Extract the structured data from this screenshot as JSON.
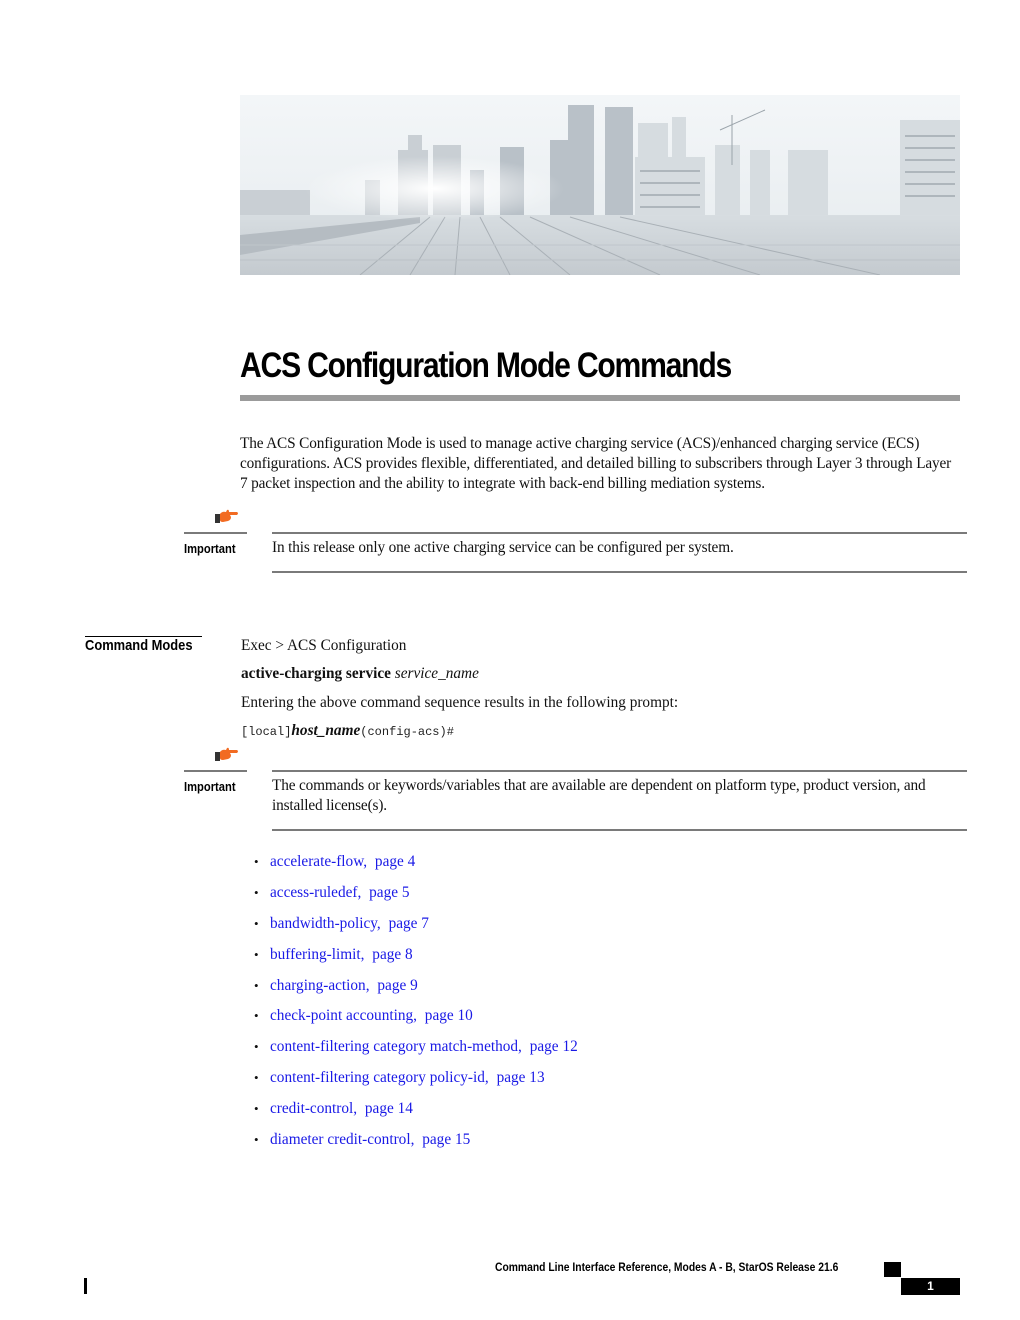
{
  "hero": {
    "image_alt": "City skyline viewed from a bridge deck"
  },
  "title": "ACS Configuration Mode Commands",
  "intro": "The ACS Configuration Mode is used to manage active charging service (ACS)/enhanced charging service (ECS) configurations. ACS provides flexible, differentiated, and detailed billing to subscribers through Layer 3 through Layer 7 packet inspection and the ability to integrate with back-end billing mediation systems.",
  "notes": [
    {
      "icon": "pointing-hand-icon",
      "label": "Important",
      "text": "In this release only one active charging service can be configured per system."
    },
    {
      "icon": "pointing-hand-icon",
      "label": "Important",
      "text": "The commands or keywords/variables that are available are dependent on platform type, product version, and installed license(s)."
    }
  ],
  "command_modes": {
    "label": "Command Modes",
    "path": "Exec > ACS Configuration",
    "command_bold": "active-charging service",
    "command_arg": "service_name",
    "description": "Entering the above command sequence results in the following prompt:",
    "prompt_prefix": "[local]",
    "prompt_host": "host_name",
    "prompt_suffix": "(config-acs)#"
  },
  "links": [
    {
      "name": "accelerate-flow,",
      "page_label": "page",
      "page": "4"
    },
    {
      "name": "access-ruledef,",
      "page_label": "page",
      "page": "5"
    },
    {
      "name": "bandwidth-policy,",
      "page_label": "page",
      "page": "7"
    },
    {
      "name": "buffering-limit,",
      "page_label": "page",
      "page": "8"
    },
    {
      "name": "charging-action,",
      "page_label": "page",
      "page": "9"
    },
    {
      "name": "check-point accounting,",
      "page_label": "page",
      "page": "10"
    },
    {
      "name": "content-filtering category match-method,",
      "page_label": "page",
      "page": "12"
    },
    {
      "name": "content-filtering category policy-id,",
      "page_label": "page",
      "page": "13"
    },
    {
      "name": "credit-control,",
      "page_label": "page",
      "page": "14"
    },
    {
      "name": "diameter credit-control,",
      "page_label": "page",
      "page": "15"
    }
  ],
  "footer": {
    "book_title": "Command Line Interface Reference, Modes A - B, StarOS Release 21.6",
    "page_number": "1"
  },
  "colors": {
    "link": "#1a1ae6",
    "rule": "#7a7a7a",
    "title_rule": "#9b9b9b",
    "note_icon": "#f26b22"
  }
}
